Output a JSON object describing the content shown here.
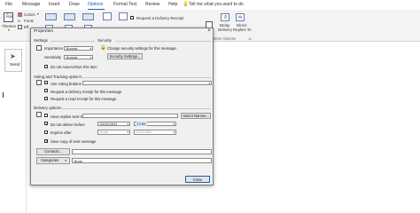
{
  "menu": {
    "items": [
      "File",
      "Message",
      "Insert",
      "Draw",
      "Options",
      "Format Text",
      "Review",
      "Help"
    ],
    "tellme": "Tell me what you want to do"
  },
  "ribbon": {
    "themes_label": "Themes",
    "colors_label": "Colors",
    "fonts_label": "Fonts",
    "effects_label": "Eff",
    "request_delivery": "Request a Delivery Receipt",
    "delay_delivery_label": [
      "Delay",
      "Delivery"
    ],
    "direct_replies_label": [
      "Direct",
      "Replies To"
    ],
    "more_options_group": "More Options"
  },
  "leftpane": {
    "send_label": "Send"
  },
  "dialog": {
    "title": "Properties",
    "close_glyph": "×",
    "settings_group": "Settings",
    "importance_label": "Importance",
    "importance_value": "Normal",
    "sensitivity_label": "Sensitivity",
    "sensitivity_value": "Normal",
    "no_autoarchive": "Do not AutoArchive this item",
    "security_group": "Security",
    "security_text": "Change security settings for this message.",
    "security_button": "Security Settings...",
    "voting_group": "Voting and Tracking options",
    "use_voting": "Use voting buttons",
    "request_delivery": "Request a delivery receipt for this message",
    "request_read": "Request a read receipt for this message",
    "delivery_group": "Delivery options",
    "replies_sent_to": "Have replies sent to",
    "select_names": "Select Names...",
    "do_not_deliver": "Do not deliver before",
    "deliver_date": "20/10/2021",
    "deliver_time": "17:00",
    "expires_after": "Expires after",
    "expires_date": "None",
    "expires_time": "12:00 AM",
    "save_copy": "Save copy of sent message",
    "contacts_button": "Contacts...",
    "categories_button": "Categories",
    "categories_value": "None",
    "close_button": "Close"
  },
  "colors": {
    "accent": "#1b5fae",
    "ribbon_bg": "#f3f3f3",
    "dialog_bg": "#f0f0f0",
    "highlight": "#cfe3f7"
  }
}
